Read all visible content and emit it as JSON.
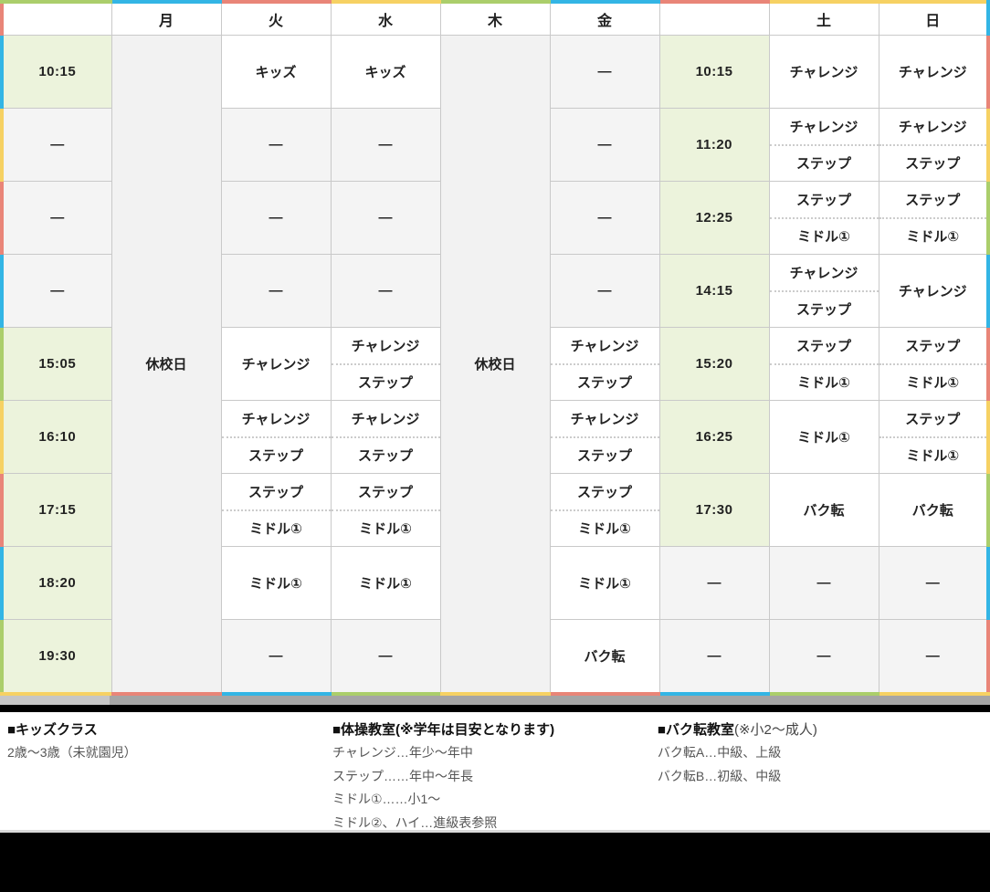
{
  "palette": {
    "green": "#abce6b",
    "blue": "#33b5e5",
    "red": "#e98578",
    "yellow": "#f6d163"
  },
  "table": {
    "columns": [
      {
        "key": "weekday-time",
        "label": ""
      },
      {
        "key": "mon",
        "label": "月"
      },
      {
        "key": "tue",
        "label": "火"
      },
      {
        "key": "wed",
        "label": "水"
      },
      {
        "key": "thu",
        "label": "木"
      },
      {
        "key": "fri",
        "label": "金"
      },
      {
        "key": "weekend-time",
        "label": ""
      },
      {
        "key": "sat",
        "label": "土"
      },
      {
        "key": "sun",
        "label": "日"
      }
    ],
    "closed_label": "休校日",
    "dash": "—",
    "border_colors": {
      "top": [
        "green",
        "blue",
        "red",
        "yellow",
        "green",
        "blue",
        "red",
        "yellow",
        "yellow"
      ],
      "bottom": [
        "yellow",
        "red",
        "blue",
        "green",
        "yellow",
        "red",
        "blue",
        "green",
        "yellow"
      ],
      "left": [
        "red",
        "blue",
        "yellow",
        "red",
        "blue",
        "green",
        "yellow",
        "red",
        "blue",
        "green"
      ],
      "right": [
        "blue",
        "red",
        "yellow",
        "green",
        "blue",
        "red",
        "yellow",
        "green",
        "blue",
        "red"
      ]
    },
    "rows": [
      {
        "cells": [
          {
            "kind": "time",
            "text": "10:15"
          },
          {
            "kind": "single",
            "text": "キッズ"
          },
          {
            "kind": "single",
            "text": "キッズ"
          },
          {
            "kind": "empty"
          },
          {
            "kind": "time",
            "text": "10:15"
          },
          {
            "kind": "single",
            "text": "チャレンジ"
          },
          {
            "kind": "single",
            "text": "チャレンジ"
          }
        ]
      },
      {
        "cells": [
          {
            "kind": "empty"
          },
          {
            "kind": "empty"
          },
          {
            "kind": "empty"
          },
          {
            "kind": "empty"
          },
          {
            "kind": "time",
            "text": "11:20"
          },
          {
            "kind": "split",
            "items": [
              "チャレンジ",
              "ステップ"
            ]
          },
          {
            "kind": "split",
            "items": [
              "チャレンジ",
              "ステップ"
            ]
          }
        ]
      },
      {
        "cells": [
          {
            "kind": "empty"
          },
          {
            "kind": "empty"
          },
          {
            "kind": "empty"
          },
          {
            "kind": "empty"
          },
          {
            "kind": "time",
            "text": "12:25"
          },
          {
            "kind": "split",
            "items": [
              "ステップ",
              "ミドル①"
            ]
          },
          {
            "kind": "split",
            "items": [
              "ステップ",
              "ミドル①"
            ]
          }
        ]
      },
      {
        "cells": [
          {
            "kind": "empty"
          },
          {
            "kind": "empty"
          },
          {
            "kind": "empty"
          },
          {
            "kind": "empty"
          },
          {
            "kind": "time",
            "text": "14:15"
          },
          {
            "kind": "split",
            "items": [
              "チャレンジ",
              "ステップ"
            ]
          },
          {
            "kind": "single",
            "text": "チャレンジ"
          }
        ]
      },
      {
        "cells": [
          {
            "kind": "time",
            "text": "15:05"
          },
          {
            "kind": "single",
            "text": "チャレンジ"
          },
          {
            "kind": "split",
            "items": [
              "チャレンジ",
              "ステップ"
            ]
          },
          {
            "kind": "split",
            "items": [
              "チャレンジ",
              "ステップ"
            ]
          },
          {
            "kind": "time",
            "text": "15:20"
          },
          {
            "kind": "split",
            "items": [
              "ステップ",
              "ミドル①"
            ]
          },
          {
            "kind": "split",
            "items": [
              "ステップ",
              "ミドル①"
            ]
          }
        ]
      },
      {
        "cells": [
          {
            "kind": "time",
            "text": "16:10"
          },
          {
            "kind": "split",
            "items": [
              "チャレンジ",
              "ステップ"
            ]
          },
          {
            "kind": "split",
            "items": [
              "チャレンジ",
              "ステップ"
            ]
          },
          {
            "kind": "split",
            "items": [
              "チャレンジ",
              "ステップ"
            ]
          },
          {
            "kind": "time",
            "text": "16:25"
          },
          {
            "kind": "single",
            "text": "ミドル①"
          },
          {
            "kind": "split",
            "items": [
              "ステップ",
              "ミドル①"
            ]
          }
        ]
      },
      {
        "cells": [
          {
            "kind": "time",
            "text": "17:15"
          },
          {
            "kind": "split",
            "items": [
              "ステップ",
              "ミドル①"
            ]
          },
          {
            "kind": "split",
            "items": [
              "ステップ",
              "ミドル①"
            ]
          },
          {
            "kind": "split",
            "items": [
              "ステップ",
              "ミドル①"
            ]
          },
          {
            "kind": "time",
            "text": "17:30"
          },
          {
            "kind": "single",
            "text": "バク転"
          },
          {
            "kind": "single",
            "text": "バク転"
          }
        ]
      },
      {
        "cells": [
          {
            "kind": "time",
            "text": "18:20"
          },
          {
            "kind": "single",
            "text": "ミドル①"
          },
          {
            "kind": "single",
            "text": "ミドル①"
          },
          {
            "kind": "single",
            "text": "ミドル①"
          },
          {
            "kind": "empty"
          },
          {
            "kind": "empty"
          },
          {
            "kind": "empty"
          }
        ]
      },
      {
        "cells": [
          {
            "kind": "time",
            "text": "19:30"
          },
          {
            "kind": "empty"
          },
          {
            "kind": "empty"
          },
          {
            "kind": "single",
            "text": "バク転"
          },
          {
            "kind": "empty"
          },
          {
            "kind": "empty"
          },
          {
            "kind": "empty"
          }
        ]
      }
    ]
  },
  "legend": {
    "sections": [
      {
        "title": "■キッズクラス",
        "suffix": "",
        "lines": [
          "2歳〜3歳（未就園児）"
        ]
      },
      {
        "title": "■体操教室(※学年は目安となります)",
        "suffix": "",
        "lines": [
          "チャレンジ…年少〜年中",
          "ステップ……年中〜年長",
          "ミドル①……小1〜",
          "ミドル②、ハイ…進級表参照"
        ]
      },
      {
        "title": "■バク転教室",
        "suffix": "(※小2〜成人)",
        "lines": [
          "バク転A…中級、上級",
          "バク転B…初級、中級"
        ]
      }
    ]
  }
}
